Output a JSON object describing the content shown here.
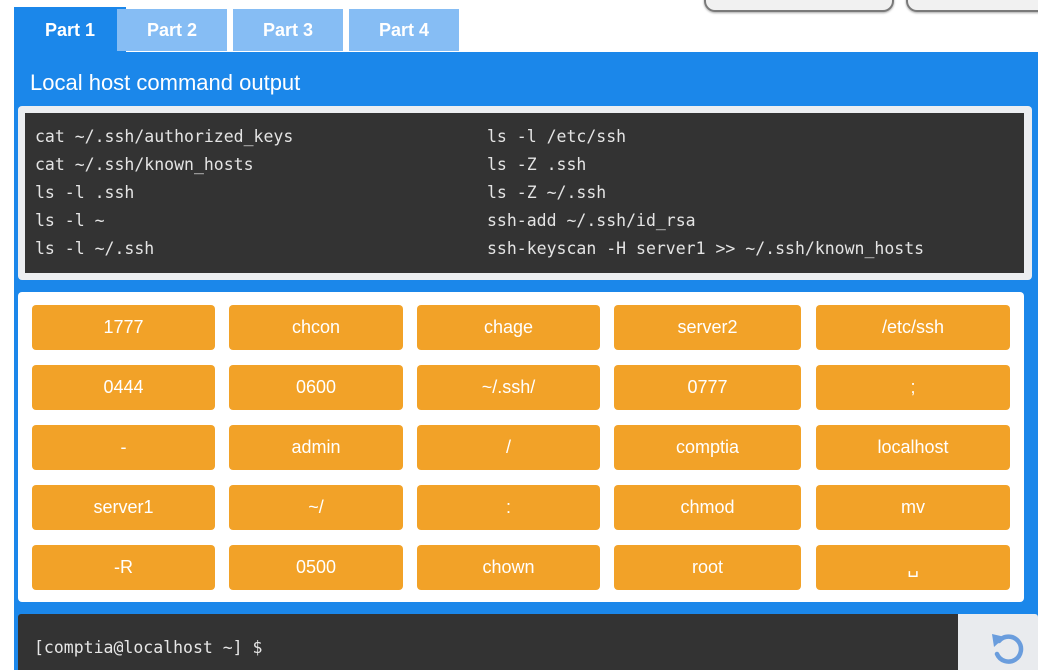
{
  "tabs": [
    "Part 1",
    "Part 2",
    "Part 3",
    "Part 4"
  ],
  "active_tab": "Part 1",
  "panel": {
    "title": "Local host command output"
  },
  "output": {
    "left": [
      "cat ~/.ssh/authorized_keys",
      "cat ~/.ssh/known_hosts",
      "ls -l .ssh",
      "ls -l ~",
      "ls -l ~/.ssh"
    ],
    "right": [
      "ls -l /etc/ssh",
      "ls -Z .ssh",
      "ls -Z ~/.ssh",
      "ssh-add ~/.ssh/id_rsa",
      "ssh-keyscan -H server1 >> ~/.ssh/known_hosts"
    ]
  },
  "keypad": [
    [
      "1777",
      "chcon",
      "chage",
      "server2",
      "/etc/ssh"
    ],
    [
      "0444",
      "0600",
      "~/.ssh/",
      "0777",
      ";"
    ],
    [
      "-",
      "admin",
      "/",
      "comptia",
      "localhost"
    ],
    [
      "server1",
      "~/",
      ":",
      "chmod",
      "mv"
    ],
    [
      "-R",
      "0500",
      "chown",
      "root",
      "␣"
    ]
  ],
  "terminal": {
    "prompt": "[comptia@localhost ~] $"
  },
  "reset_button": {
    "icon": "reset-icon"
  },
  "colors": {
    "accent": "#1b87ea",
    "tab_inactive": "#86bdf4",
    "key": "#f2a228",
    "terminal_bg": "#333333"
  }
}
